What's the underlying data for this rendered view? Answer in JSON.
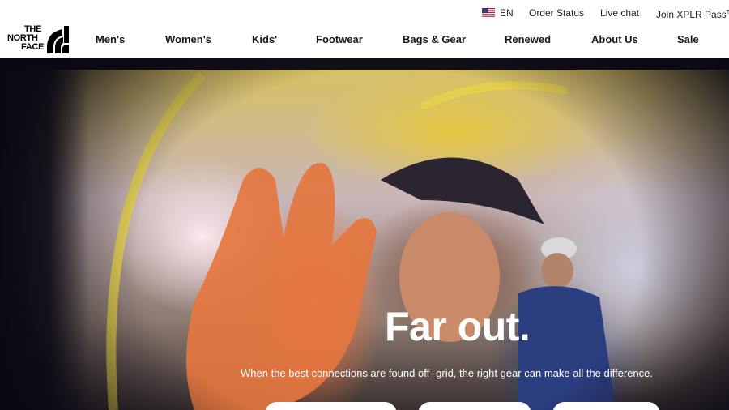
{
  "brand": {
    "logo_lines": [
      "THE",
      "NORTH",
      "FACE"
    ]
  },
  "utility": {
    "language": "EN",
    "order_status": "Order Status",
    "live_chat": "Live chat",
    "join": "Join XPLR Pass",
    "join_mark": "T"
  },
  "nav": {
    "items": [
      "Men's",
      "Women's",
      "Kids'",
      "Footwear",
      "Bags & Gear",
      "Renewed",
      "About Us",
      "Sale"
    ]
  },
  "hero": {
    "title": "Far out.",
    "subtitle": "When the best connections are found off- grid, the right gear can make all the difference.",
    "buttons": [
      "",
      "",
      ""
    ]
  },
  "colors": {
    "text": "#111111",
    "hero_text": "#ffffff",
    "header_bg": "#ffffff"
  },
  "icons": [
    "us-flag-icon",
    "north-face-logo-mark"
  ]
}
